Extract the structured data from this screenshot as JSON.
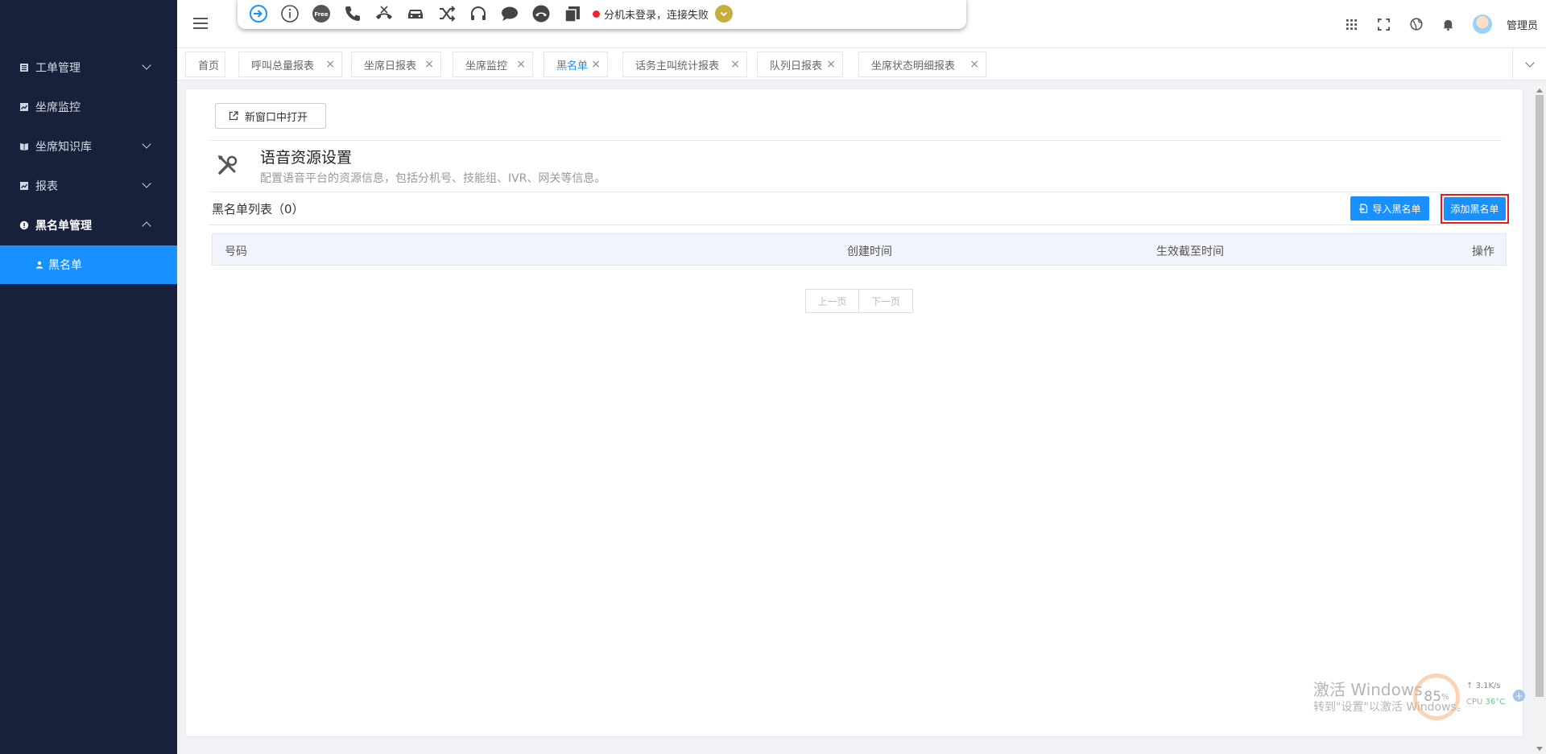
{
  "sidebar": {
    "items": [
      {
        "label": "工单管理",
        "icon": "list-icon"
      },
      {
        "label": "坐席监控",
        "icon": "chart-icon"
      },
      {
        "label": "坐席知识库",
        "icon": "book-icon"
      },
      {
        "label": "报表",
        "icon": "chart-icon"
      },
      {
        "label": "黑名单管理",
        "icon": "alert-icon"
      },
      {
        "label": "黑名单",
        "icon": "user-icon"
      }
    ]
  },
  "toolbar": {
    "free_label": "Free",
    "status_text": "分机未登录，连接失败"
  },
  "header": {
    "user_name": "管理员"
  },
  "tabs": [
    {
      "label": "首页"
    },
    {
      "label": "呼叫总量报表"
    },
    {
      "label": "坐席日报表"
    },
    {
      "label": "坐席监控"
    },
    {
      "label": "黑名单"
    },
    {
      "label": "话务主叫统计报表"
    },
    {
      "label": "队列日报表"
    },
    {
      "label": "坐席状态明细报表"
    }
  ],
  "content": {
    "open_new_window": "新窗口中打开",
    "title": "语音资源设置",
    "description": "配置语音平台的资源信息，包括分机号、技能组、IVR、网关等信息。",
    "list_title": "黑名单列表（0）",
    "import_button": "导入黑名单",
    "add_button": "添加黑名单",
    "table_headers": [
      "号码",
      "创建时间",
      "生效截至时间",
      "操作"
    ],
    "pager": {
      "prev": "上一页",
      "next": "下一页"
    }
  },
  "overlay": {
    "watermark_line1": "激活 Windows",
    "watermark_line2": "转到\"设置\"以激活 Windows。",
    "monitor_percent": "85",
    "monitor_percent_unit": "%",
    "monitor_speed": "3.1K/s",
    "monitor_cpu_label": "CPU",
    "monitor_cpu_temp": "36°C"
  },
  "colors": {
    "sidebar_bg": "#17213b",
    "accent": "#1890ff",
    "highlight_border": "#e51c23",
    "status_error": "#f5222d"
  }
}
